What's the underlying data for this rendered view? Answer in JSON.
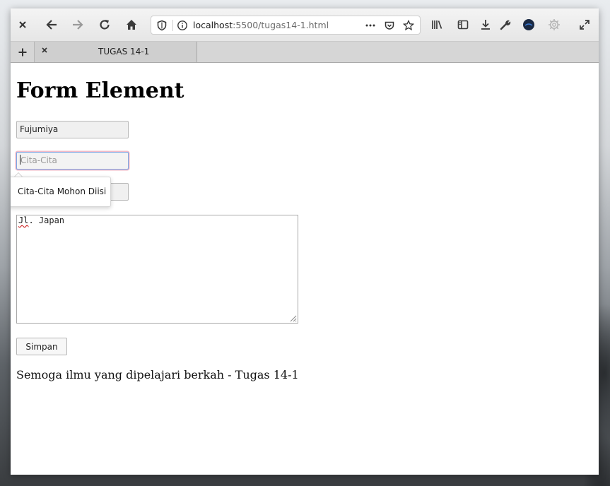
{
  "browser": {
    "url_host": "localhost",
    "url_rest": ":5500/tugas14-1.html",
    "tab_title": "TUGAS 14-1",
    "icons": [
      "close-icon",
      "back-icon",
      "forward-icon",
      "reload-icon",
      "home-icon",
      "shield-icon",
      "info-icon",
      "more-icon",
      "pocket-icon",
      "star-icon",
      "library-icon",
      "sidebar-icon",
      "download-icon",
      "wrench-icon",
      "account-icon",
      "settings-gear-icon",
      "fullscreen-icon",
      "new-tab-icon",
      "tab-close-icon"
    ]
  },
  "page": {
    "heading": "Form Element",
    "name_value": "Fujumiya",
    "cita_placeholder": "Cita-Cita",
    "validation_message": "Cita-Cita Mohon Diisi",
    "address_prefix": "Jl",
    "address_rest": ". Japan",
    "submit_label": "Simpan",
    "footer": "Semoga ilmu yang dipelajari berkah - Tugas 14-1"
  },
  "colors": {
    "focus_border": "#7aa7e6",
    "invalid_glow": "#f2b8c6",
    "account_icon": "#1b2a44"
  }
}
